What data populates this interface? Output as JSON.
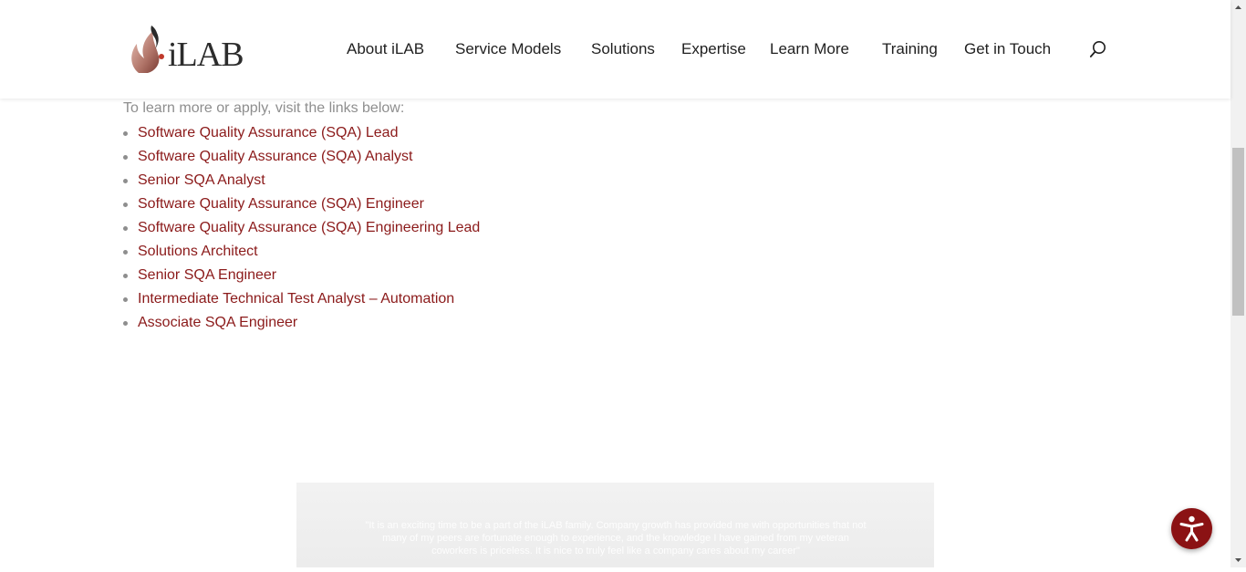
{
  "header": {
    "logo_text": "iLAB",
    "nav": [
      {
        "label": "About iLAB"
      },
      {
        "label": "Service Models"
      },
      {
        "label": "Solutions"
      },
      {
        "label": "Expertise"
      },
      {
        "label": "Learn More"
      },
      {
        "label": "Training"
      },
      {
        "label": "Get in Touch"
      }
    ],
    "search_icon": "search-icon"
  },
  "main": {
    "intro": "To learn more or apply, visit the links below:",
    "jobs": [
      "Software Quality Assurance (SQA) Lead",
      "Software Quality Assurance (SQA) Analyst",
      "Senior SQA Analyst",
      "Software Quality Assurance (SQA) Engineer",
      "Software Quality Assurance (SQA) Engineering Lead",
      "Solutions Architect",
      "Senior SQA Engineer",
      "Intermediate Technical Test Analyst – Automation",
      "Associate SQA Engineer"
    ],
    "testimonial": "\"It is an exciting time to be a part of the iLAB family. Company growth has provided me with opportunities that not many of my peers are fortunate enough to experience, and the knowledge I have gained from my veteran coworkers is priceless. It is nice to truly feel like a company cares about my career\""
  },
  "accessibility_button": {
    "icon": "accessibility-icon"
  },
  "colors": {
    "link": "#8b1a1a",
    "muted_text": "#8e8e8e",
    "accent": "#8b1214"
  }
}
